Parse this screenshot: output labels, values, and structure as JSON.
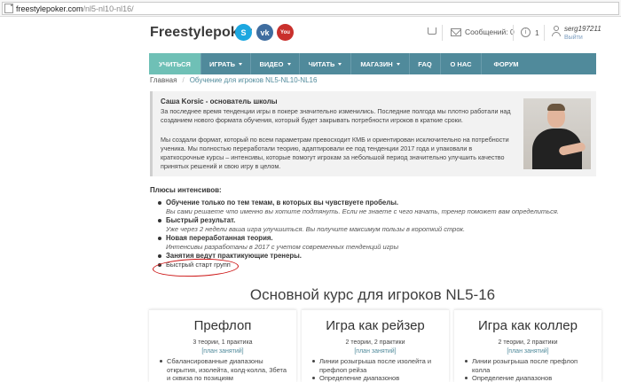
{
  "browser": {
    "domain": "freestylepoker.com",
    "path": "/nl5-nl10-nl16/"
  },
  "header": {
    "logo": "Freestylepoker",
    "social": [
      {
        "icon": "skype-icon",
        "glyph": "S"
      },
      {
        "icon": "vk-icon",
        "glyph": "vk"
      },
      {
        "icon": "youtube-icon",
        "glyph": "You"
      }
    ],
    "messages_label": "Сообщений: 0",
    "notifications_count": "1",
    "username": "serg197211",
    "logout_label": "Выйти"
  },
  "nav": [
    {
      "label": "УЧИТЬСЯ",
      "active": true,
      "dropdown": false
    },
    {
      "label": "ИГРАТЬ",
      "dropdown": true
    },
    {
      "label": "ВИДЕО",
      "dropdown": true
    },
    {
      "label": "ЧИТАТЬ",
      "dropdown": true
    },
    {
      "label": "МАГАЗИН",
      "dropdown": true
    },
    {
      "label": "FAQ",
      "dropdown": false
    },
    {
      "label": "О НАС",
      "dropdown": false
    },
    {
      "label": "ФОРУМ",
      "dropdown": false
    }
  ],
  "breadcrumb": {
    "home": "Главная",
    "current": "Обучение для игроков NL5-NL10-NL16"
  },
  "intro": {
    "author": "Саша Korsic - основатель школы",
    "p1": "За последнее время тенденции игры в покере значительно изменились. Последние полгода мы плотно работали над созданием нового формата обучения, который будет закрывать потребности игроков в краткие сроки.",
    "p2": "Мы создали формат, который по всем параметрам превосходит КМБ и ориентирован исключительно на потребности ученика. Мы полностью переработали теорию, адаптировали ее под тенденции 2017 года и упаковали в краткосрочные курсы – интенсивы, которые помогут игрокам за небольшой период значительно улучшить качество принятых решений и свою игру в целом."
  },
  "benefits": {
    "title": "Плюсы интенсивов:",
    "items": [
      {
        "title": "Обучение только по тем темам, в которых вы чувствуете пробелы.",
        "desc": "Вы сами решаете что именно вы хотите подтянуть. Если не знаете с чего начать, тренер поможет вам определиться."
      },
      {
        "title": "Быстрый результат.",
        "desc": "Уже через 2 недели ваша игра улучшиться. Вы получите максимум пользы в короткий строк."
      },
      {
        "title": "Новая переработанная теория.",
        "desc": "Интенсивы разработаны в 2017 с учетом современных тенденций игры"
      },
      {
        "title": "Занятия ведут практикующие тренеры.",
        "desc": ""
      }
    ],
    "highlighted": "Быстрый старт групп"
  },
  "course": {
    "title": "Основной курс для игроков NL5-16",
    "cards": [
      {
        "title": "Префлоп",
        "sub": "3 теории, 1 практика",
        "plan": "[план занятий]",
        "items": [
          "Сбалансированные диапазоны открытия, изолейта, колд-колла, 3бета и сквиза по позициям"
        ]
      },
      {
        "title": "Игра как рейзер",
        "sub": "2 теории, 2 практики",
        "plan": "[план занятий]",
        "items": [
          "Линии розыгрыша после изолейта и префлоп рейза",
          "Определение диапазонов"
        ]
      },
      {
        "title": "Игра как коллер",
        "sub": "2 теории, 2 практики",
        "plan": "[план занятий]",
        "items": [
          "Линии розыгрыша после префлоп колла",
          "Определение диапазонов"
        ]
      }
    ]
  }
}
